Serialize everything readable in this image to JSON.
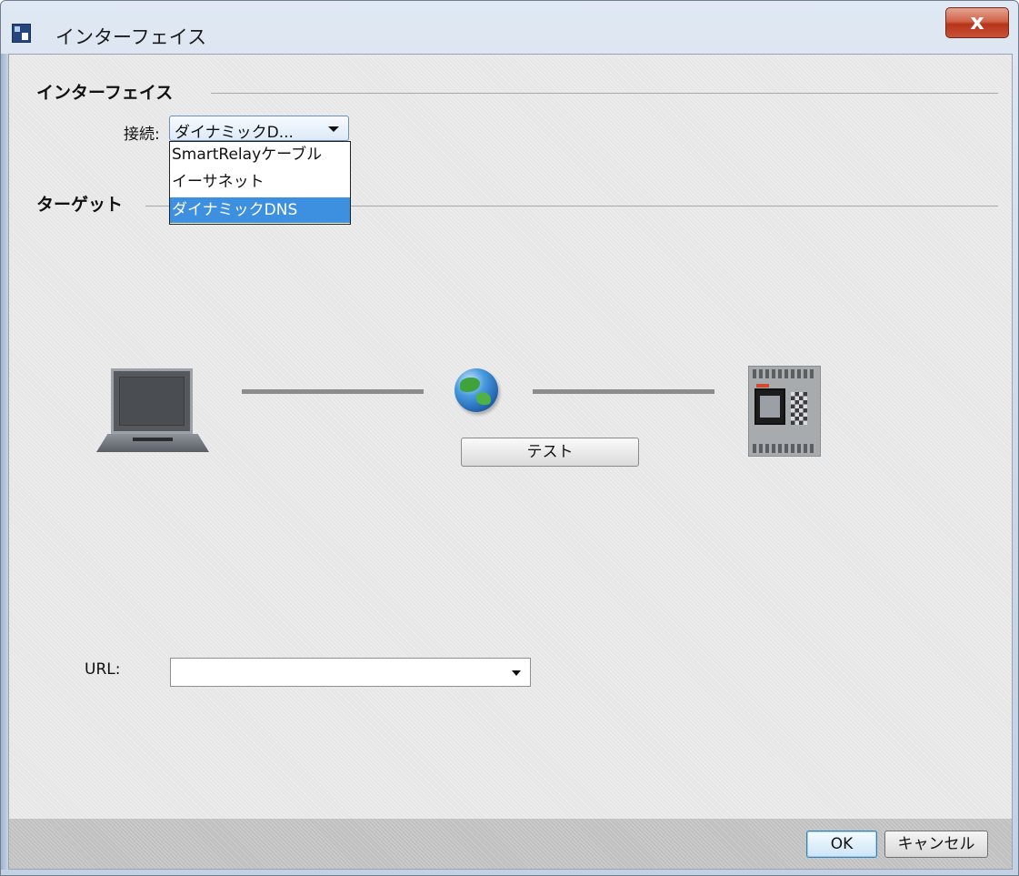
{
  "window": {
    "title": "インターフェイス",
    "close_label": "x"
  },
  "interface_group": {
    "title": "インターフェイス",
    "connection_label": "接続:",
    "connection_value": "ダイナミックD...",
    "options": [
      "SmartRelayケーブル",
      "イーサネット",
      "ダイナミックDNS"
    ],
    "selected_option": "ダイナミックDNS"
  },
  "target_group": {
    "title": "ターゲット",
    "test_button": "テスト",
    "url_label": "URL:",
    "url_value": ""
  },
  "footer": {
    "ok": "OK",
    "cancel": "キャンセル"
  },
  "icons": {
    "app": "app-icon",
    "computer": "laptop-icon",
    "network": "globe-icon",
    "device": "plc-device-icon"
  },
  "colors": {
    "selection": "#3d8fe0",
    "close_button": "#c75238",
    "client_background": "#e6e6e6"
  }
}
